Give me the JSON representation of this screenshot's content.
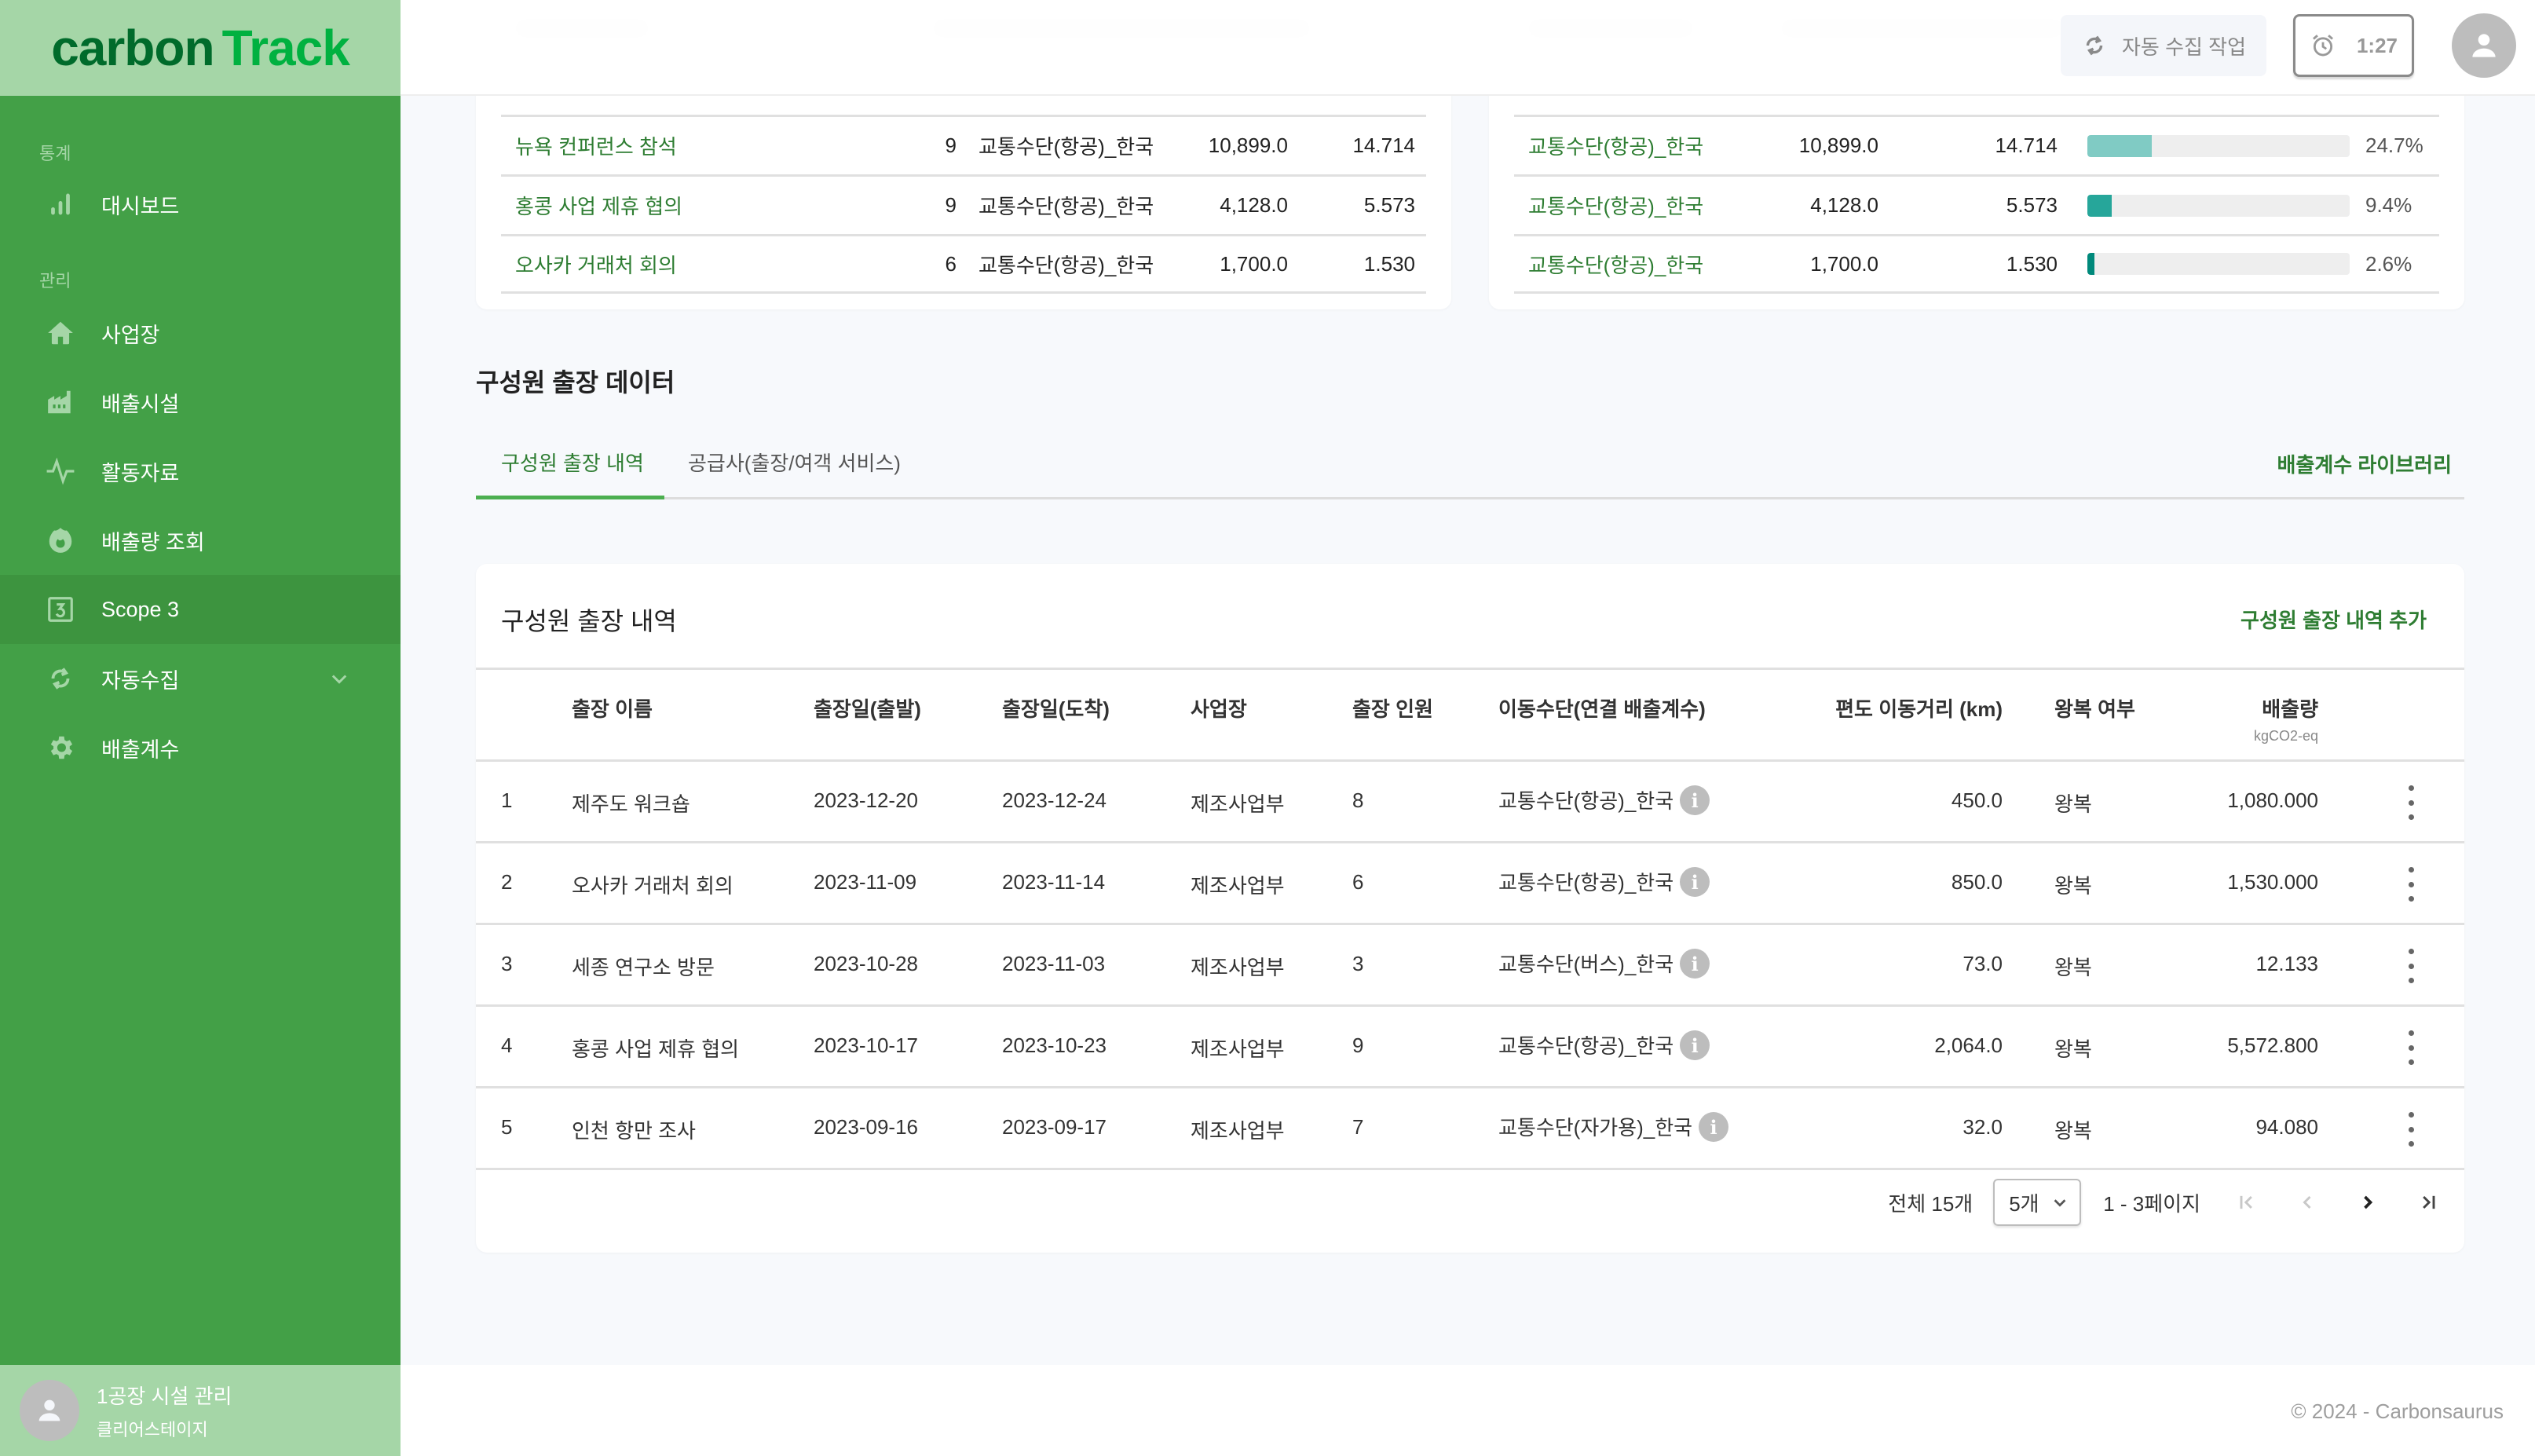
{
  "app": {
    "logo_part1": "carbon",
    "logo_part2": "Track"
  },
  "sidebar": {
    "sections": [
      {
        "label": "통계"
      },
      {
        "label": "관리"
      }
    ],
    "items": [
      {
        "label": "대시보드",
        "icon": "bar-chart-icon"
      },
      {
        "label": "사업장",
        "icon": "home-icon"
      },
      {
        "label": "배출시설",
        "icon": "factory-icon"
      },
      {
        "label": "활동자료",
        "icon": "activity-icon"
      },
      {
        "label": "배출량 조회",
        "icon": "flame-icon"
      },
      {
        "label": "Scope 3",
        "icon": "scope3-icon",
        "active": true
      },
      {
        "label": "자동수집",
        "icon": "sync-icon",
        "expandable": true
      },
      {
        "label": "배출계수",
        "icon": "gear-icon"
      }
    ],
    "user": {
      "name": "1공장 시설 관리",
      "org": "클리어스테이지"
    }
  },
  "header": {
    "auto_collect_label": "자동 수집 작업",
    "timer_value": "1:27"
  },
  "top_left_card": {
    "rows": [
      {
        "name": "뉴욕 컨퍼런스 참석",
        "people": "9",
        "transport": "교통수단(항공)_한국",
        "distance": "10,899.0",
        "emission": "14.714"
      },
      {
        "name": "홍콩 사업 제휴 협의",
        "people": "9",
        "transport": "교통수단(항공)_한국",
        "distance": "4,128.0",
        "emission": "5.573"
      },
      {
        "name": "오사카 거래처 회의",
        "people": "6",
        "transport": "교통수단(항공)_한국",
        "distance": "1,700.0",
        "emission": "1.530"
      }
    ]
  },
  "top_right_card": {
    "rows": [
      {
        "transport": "교통수단(항공)_한국",
        "distance": "10,899.0",
        "emission": "14.714",
        "share_pct": 24.7,
        "share_label": "24.7%",
        "bar_color": "#80cbc4"
      },
      {
        "transport": "교통수단(항공)_한국",
        "distance": "4,128.0",
        "emission": "5.573",
        "share_pct": 9.4,
        "share_label": "9.4%",
        "bar_color": "#26a69a"
      },
      {
        "transport": "교통수단(항공)_한국",
        "distance": "1,700.0",
        "emission": "1.530",
        "share_pct": 2.6,
        "share_label": "2.6%",
        "bar_color": "#00897b"
      }
    ]
  },
  "section": {
    "title": "구성원 출장 데이터",
    "tabs": [
      {
        "label": "구성원 출장 내역",
        "active": true
      },
      {
        "label": "공급사(출장/여객 서비스)"
      }
    ],
    "library_link": "배출계수 라이브러리"
  },
  "trips_table": {
    "title": "구성원 출장 내역",
    "add_button": "구성원 출장 내역 추가",
    "columns": {
      "name": "출장 이름",
      "depart": "출장일(출발)",
      "arrive": "출장일(도착)",
      "site": "사업장",
      "people": "출장 인원",
      "transport": "이동수단(연결 배출계수)",
      "distance": "편도 이동거리 (km)",
      "round_trip": "왕복 여부",
      "emission": "배출량",
      "emission_unit": "kgCO2-eq"
    },
    "rows": [
      {
        "no": "1",
        "name": "제주도 워크숍",
        "depart": "2023-12-20",
        "arrive": "2023-12-24",
        "site": "제조사업부",
        "people": "8",
        "transport": "교통수단(항공)_한국",
        "distance": "450.0",
        "round_trip": "왕복",
        "emission": "1,080.000"
      },
      {
        "no": "2",
        "name": "오사카 거래처 회의",
        "depart": "2023-11-09",
        "arrive": "2023-11-14",
        "site": "제조사업부",
        "people": "6",
        "transport": "교통수단(항공)_한국",
        "distance": "850.0",
        "round_trip": "왕복",
        "emission": "1,530.000"
      },
      {
        "no": "3",
        "name": "세종 연구소 방문",
        "depart": "2023-10-28",
        "arrive": "2023-11-03",
        "site": "제조사업부",
        "people": "3",
        "transport": "교통수단(버스)_한국",
        "distance": "73.0",
        "round_trip": "왕복",
        "emission": "12.133"
      },
      {
        "no": "4",
        "name": "홍콩 사업 제휴 협의",
        "depart": "2023-10-17",
        "arrive": "2023-10-23",
        "site": "제조사업부",
        "people": "9",
        "transport": "교통수단(항공)_한국",
        "distance": "2,064.0",
        "round_trip": "왕복",
        "emission": "5,572.800"
      },
      {
        "no": "5",
        "name": "인천 항만 조사",
        "depart": "2023-09-16",
        "arrive": "2023-09-17",
        "site": "제조사업부",
        "people": "7",
        "transport": "교통수단(자가용)_한국",
        "distance": "32.0",
        "round_trip": "왕복",
        "emission": "94.080"
      }
    ],
    "pagination": {
      "total_label": "전체 15개",
      "page_size": "5개",
      "page_range": "1 - 3페이지"
    }
  },
  "footer": {
    "copyright": "© 2024 - Carbonsaurus"
  }
}
